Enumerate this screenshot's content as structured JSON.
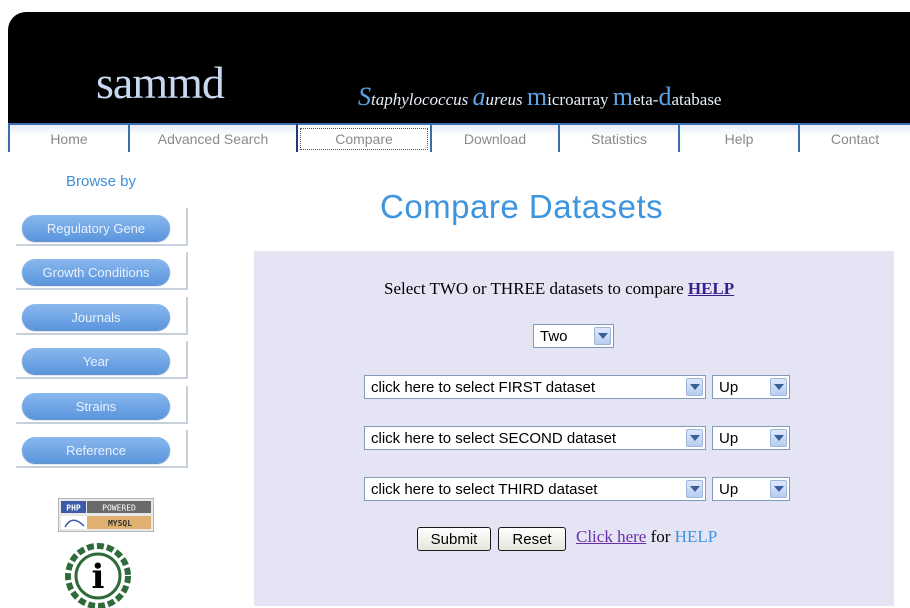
{
  "header": {
    "logo": "sammd",
    "tagline_parts": [
      {
        "cap": "S",
        "rest": "taphylococcus ",
        "italic": true
      },
      {
        "cap": "a",
        "rest": "ureus ",
        "italic": true
      },
      {
        "cap": "m",
        "rest": "icroarray ",
        "italic": false
      },
      {
        "cap": "m",
        "rest": "eta-",
        "italic": false
      },
      {
        "cap": "d",
        "rest": "atabase",
        "italic": false
      }
    ]
  },
  "nav": {
    "tabs": [
      {
        "label": "Home",
        "active": false
      },
      {
        "label": "Advanced Search",
        "active": false
      },
      {
        "label": "Compare",
        "active": true
      },
      {
        "label": "Download",
        "active": false
      },
      {
        "label": "Statistics",
        "active": false
      },
      {
        "label": "Help",
        "active": false
      },
      {
        "label": "Contact",
        "active": false
      }
    ]
  },
  "sidebar": {
    "heading": "Browse by",
    "items": [
      {
        "label": "Regulatory Gene"
      },
      {
        "label": "Growth Conditions"
      },
      {
        "label": "Journals"
      },
      {
        "label": "Year"
      },
      {
        "label": "Strains"
      },
      {
        "label": "Reference"
      }
    ],
    "badge": {
      "php": "PHP",
      "powered": "POWERED",
      "mysql": "MYSQL"
    },
    "info_letter": "i"
  },
  "main": {
    "title": "Compare Datasets",
    "instructions": "Select TWO or THREE datasets to compare",
    "instructions_link": "HELP",
    "count_select": {
      "value": "Two"
    },
    "datasets": [
      {
        "value": "click here to select FIRST dataset",
        "direction": "Up"
      },
      {
        "value": "click here to select SECOND dataset",
        "direction": "Up"
      },
      {
        "value": "click here to select THIRD dataset",
        "direction": "Up"
      }
    ],
    "submit_label": "Submit",
    "reset_label": "Reset",
    "click_here": "Click here",
    "for_text": " for ",
    "help_text": "HELP"
  },
  "colors": {
    "accent": "#3d95e0",
    "header_bg": "#000000",
    "panel_bg": "#e4e4f5",
    "link": "#3a1e8c"
  }
}
